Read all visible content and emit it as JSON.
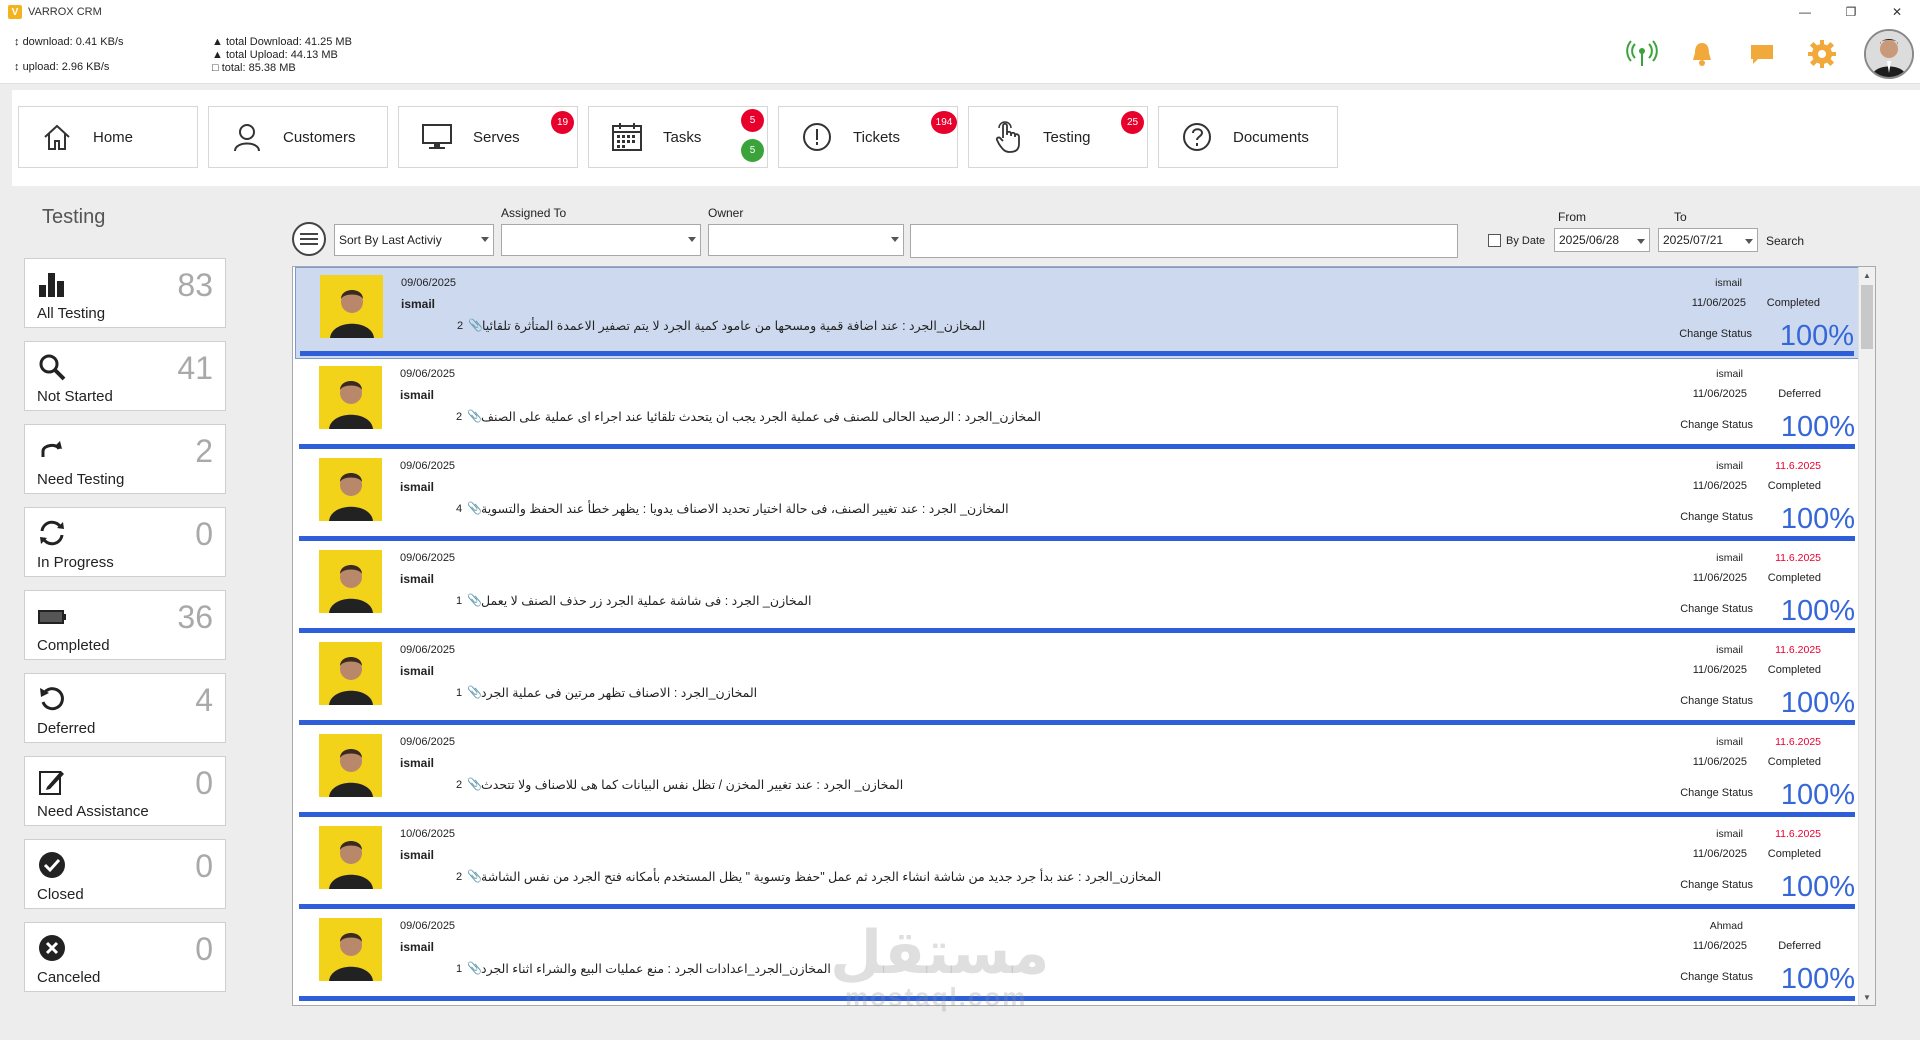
{
  "window": {
    "title": "VARROX CRM",
    "logo_text": "V"
  },
  "net_stats": {
    "download": "download: 0.41 KB/s",
    "upload": "upload: 2.96 KB/s",
    "total_download": "total Download: 41.25 MB",
    "total_upload": "total Upload: 44.13 MB",
    "total": "total: 85.38 MB"
  },
  "nav": [
    {
      "label": "Home",
      "icon": "home-icon"
    },
    {
      "label": "Customers",
      "icon": "user-icon"
    },
    {
      "label": "Serves",
      "icon": "monitor-icon",
      "badges": [
        "19"
      ]
    },
    {
      "label": "Tasks",
      "icon": "calendar-icon",
      "badges": [
        "5",
        "5"
      ]
    },
    {
      "label": "Tickets",
      "icon": "exclamation-icon",
      "badges": [
        "194"
      ]
    },
    {
      "label": "Testing",
      "icon": "hand-pointer-icon",
      "badges": [
        "25"
      ]
    },
    {
      "label": "Documents",
      "icon": "question-icon"
    }
  ],
  "colors": {
    "badge_red": "#e8002c",
    "badge_green": "#3aa43a",
    "accent_blue": "#3567d9",
    "header_icon_green": "#3aa43a",
    "header_icon_orange": "#f2a93b"
  },
  "section_title": "Testing",
  "stats": [
    {
      "label": "All Testing",
      "count": "83",
      "icon": "bar-chart-icon"
    },
    {
      "label": "Not Started",
      "count": "41",
      "icon": "search-icon"
    },
    {
      "label": "Need Testing",
      "count": "2",
      "icon": "redo-icon"
    },
    {
      "label": "In Progress",
      "count": "0",
      "icon": "sync-icon"
    },
    {
      "label": "Completed",
      "count": "36",
      "icon": "battery-icon"
    },
    {
      "label": "Deferred",
      "count": "4",
      "icon": "undo-icon"
    },
    {
      "label": "Need Assistance",
      "count": "0",
      "icon": "edit-icon"
    },
    {
      "label": "Closed",
      "count": "0",
      "icon": "check-circle-icon"
    },
    {
      "label": "Canceled",
      "count": "0",
      "icon": "x-circle-icon"
    }
  ],
  "filters": {
    "sort_value": "Sort By Last Activiy",
    "assigned_label": "Assigned To",
    "assigned_value": "",
    "owner_label": "Owner",
    "owner_value": "",
    "search_value": "",
    "by_date_label": "By Date",
    "from_label": "From",
    "from_value": "2025/06/28",
    "to_label": "To",
    "to_value": "2025/07/21",
    "search_label": "Search"
  },
  "rows": [
    {
      "date": "09/06/2025",
      "name": "ismail",
      "desc": "المخازن_الجرد : عند اضافة قمية ومسحها من عامود كمية الجرد لا يتم تصفير الاعمدة المتأثرة تلقائيا",
      "attachments": "2",
      "assignee": "ismail",
      "due": "",
      "done_date": "11/06/2025",
      "status": "Completed",
      "change": "Change Status",
      "percent": "100%"
    },
    {
      "date": "09/06/2025",
      "name": "ismail",
      "desc": "المخازن_الجرد : الرصيد الحالى للصنف فى عملية الجرد يجب ان يتحدث تلقائيا عند اجراء اى عملية على الصنف",
      "attachments": "2",
      "assignee": "ismail",
      "due": "",
      "done_date": "11/06/2025",
      "status": "Deferred",
      "change": "Change Status",
      "percent": "100%"
    },
    {
      "date": "09/06/2025",
      "name": "ismail",
      "desc": "المخازن_ الجرد : عند تغيير الصنف، فى حالة اختيار تحديد الاصناف يدويا : يظهر خطأ عند الحفظ والتسوية",
      "attachments": "4",
      "assignee": "ismail",
      "due": "11.6.2025",
      "done_date": "11/06/2025",
      "status": "Completed",
      "change": "Change Status",
      "percent": "100%"
    },
    {
      "date": "09/06/2025",
      "name": "ismail",
      "desc": "المخازن_ الجرد : فى شاشة عملية الجرد زر حذف الصنف لا يعمل",
      "attachments": "1",
      "assignee": "ismail",
      "due": "11.6.2025",
      "done_date": "11/06/2025",
      "status": "Completed",
      "change": "Change Status",
      "percent": "100%"
    },
    {
      "date": "09/06/2025",
      "name": "ismail",
      "desc": "المخازن_الجرد : الاصناف تظهر مرتين فى عملية الجرد",
      "attachments": "1",
      "assignee": "ismail",
      "due": "11.6.2025",
      "done_date": "11/06/2025",
      "status": "Completed",
      "change": "Change Status",
      "percent": "100%"
    },
    {
      "date": "09/06/2025",
      "name": "ismail",
      "desc": "المخازن_ الجرد : عند تغيير المخزن / تظل نفس البيانات كما هى للاصناف ولا تتحدث",
      "attachments": "2",
      "assignee": "ismail",
      "due": "11.6.2025",
      "done_date": "11/06/2025",
      "status": "Completed",
      "change": "Change Status",
      "percent": "100%"
    },
    {
      "date": "10/06/2025",
      "name": "ismail",
      "desc": "المخازن_الجرد : عند بدأ جرد جديد من شاشة انشاء الجرد ثم عمل \"حفظ وتسوية \" يظل المستخدم بأمكانه فتح الجرد من نفس الشاشة",
      "attachments": "2",
      "assignee": "ismail",
      "due": "11.6.2025",
      "done_date": "11/06/2025",
      "status": "Completed",
      "change": "Change Status",
      "percent": "100%"
    },
    {
      "date": "09/06/2025",
      "name": "ismail",
      "desc": "المخازن_الجرد_اعدادات الجرد : منع عمليات البيع والشراء اثناء الجرد",
      "attachments": "1",
      "assignee": "Ahmad",
      "due": "",
      "done_date": "11/06/2025",
      "status": "Deferred",
      "change": "Change Status",
      "percent": "100%"
    }
  ],
  "watermark": {
    "arabic": "مستقل",
    "latin": "mostaql.com"
  }
}
